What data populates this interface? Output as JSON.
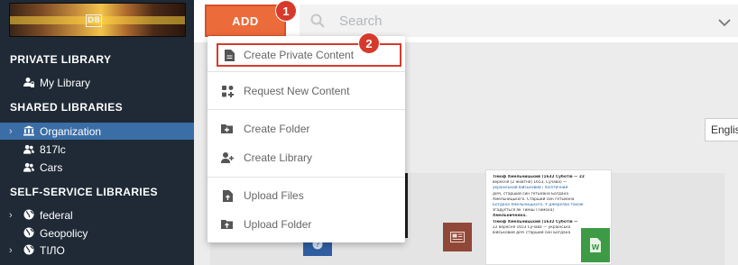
{
  "sidebar": {
    "private_title": "PRIVATE LIBRARY",
    "private_items": [
      {
        "label": "My Library",
        "icon": "user-lock-icon"
      }
    ],
    "shared_title": "SHARED LIBRARIES",
    "shared_items": [
      {
        "label": "Organization",
        "icon": "institution-icon",
        "active": true,
        "expandable": true
      },
      {
        "label": "817lc",
        "icon": "users-icon"
      },
      {
        "label": "Cars",
        "icon": "users-icon"
      }
    ],
    "selfservice_title": "SELF-SERVICE LIBRARIES",
    "selfservice_items": [
      {
        "label": "federal",
        "icon": "globe-icon",
        "expandable": true
      },
      {
        "label": "Geopolicy",
        "icon": "globe-icon"
      },
      {
        "label": "ТІЛО",
        "icon": "globe-icon",
        "expandable": true
      }
    ]
  },
  "toolbar": {
    "add_label": "ADD",
    "search_placeholder": "Search"
  },
  "annotations": {
    "step1": "1",
    "step2": "2"
  },
  "menu": {
    "items": [
      {
        "label": "Create Private Content",
        "icon": "document-icon"
      },
      {
        "label": "Request New Content",
        "icon": "grid-plus-icon"
      },
      {
        "label": "Create Folder",
        "icon": "folder-plus-icon"
      },
      {
        "label": "Create Library",
        "icon": "user-plus-icon"
      },
      {
        "label": "Upload Files",
        "icon": "file-upload-icon"
      },
      {
        "label": "Upload Folder",
        "icon": "folder-upload-icon"
      }
    ]
  },
  "content": {
    "language_button": "English",
    "doc_lines": [
      "Тімоф Хмельницький (1632 Суботів — 22",
      "вересня [2 жовтня] 1653, Сучава) —",
      "український військовий і політичний",
      "діяч, старший син гетьмана Богдана",
      "Хмельницького. Старший син гетьмана",
      "Богдана Хмельницького. У джерелах також",
      "згадується як Тиміш (Тимоха)",
      "Хмельниченко.",
      "Тімоф Хмельницький (1632 Суботів —",
      "22 вересня 1653 Сучава — українсько",
      "військовий діяч старший син Богдана"
    ]
  },
  "colors": {
    "sidebar_bg": "#1f2a36",
    "active_item": "#3b6da6",
    "add_button": "#ec6b3a",
    "annotation_red": "#d63a2c"
  }
}
